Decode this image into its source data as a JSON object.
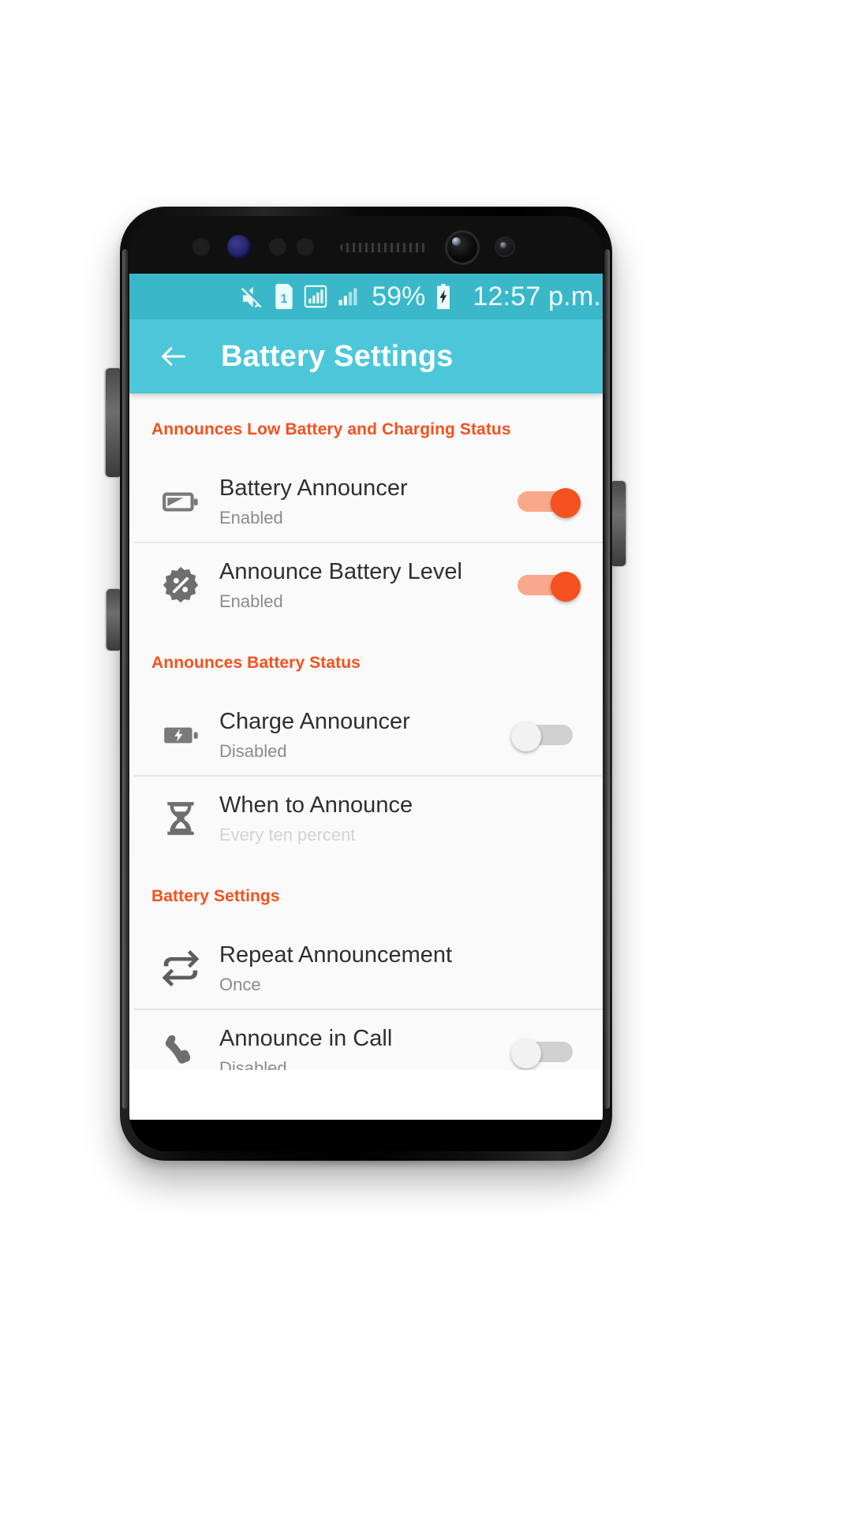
{
  "status_bar": {
    "icons": [
      "mute-icon",
      "sim-1-icon",
      "signal-bars-boxed-icon",
      "signal-bars-icon"
    ],
    "battery_percent": "59%",
    "battery_state": "charging",
    "time": "12:57 p.m."
  },
  "app_bar": {
    "back_label": "←",
    "title": "Battery Settings",
    "background": "#4cc7d9"
  },
  "theme": {
    "accent": "#f4511e",
    "app_bar": "#4cc7d9",
    "status_bar": "#3ab8c9",
    "page_bg": "#fafafa"
  },
  "sections": [
    {
      "header": "Announces Low Battery and Charging Status",
      "rows": [
        {
          "icon": "battery-half-icon",
          "title": "Battery Announcer",
          "subtitle": "Enabled",
          "control": "toggle",
          "toggle_state": "on",
          "divider": true
        },
        {
          "icon": "percent-badge-icon",
          "title": "Announce Battery Level",
          "subtitle": "Enabled",
          "control": "toggle",
          "toggle_state": "on",
          "divider": false
        }
      ]
    },
    {
      "header": "Announces Battery Status",
      "rows": [
        {
          "icon": "battery-charging-icon",
          "title": "Charge Announcer",
          "subtitle": "Disabled",
          "control": "toggle",
          "toggle_state": "off",
          "divider": true
        },
        {
          "icon": "hourglass-icon",
          "title": "When to Announce",
          "subtitle": "Every ten percent",
          "subtitle_muted": true,
          "control": "none",
          "divider": false
        }
      ]
    },
    {
      "header": "Battery Settings",
      "rows": [
        {
          "icon": "repeat-icon",
          "title": "Repeat Announcement",
          "subtitle": "Once",
          "control": "none",
          "divider": true
        },
        {
          "icon": "phone-in-call-icon",
          "title": "Announce in Call",
          "subtitle": "Disabled",
          "control": "toggle",
          "toggle_state": "off",
          "divider": false
        }
      ]
    }
  ]
}
